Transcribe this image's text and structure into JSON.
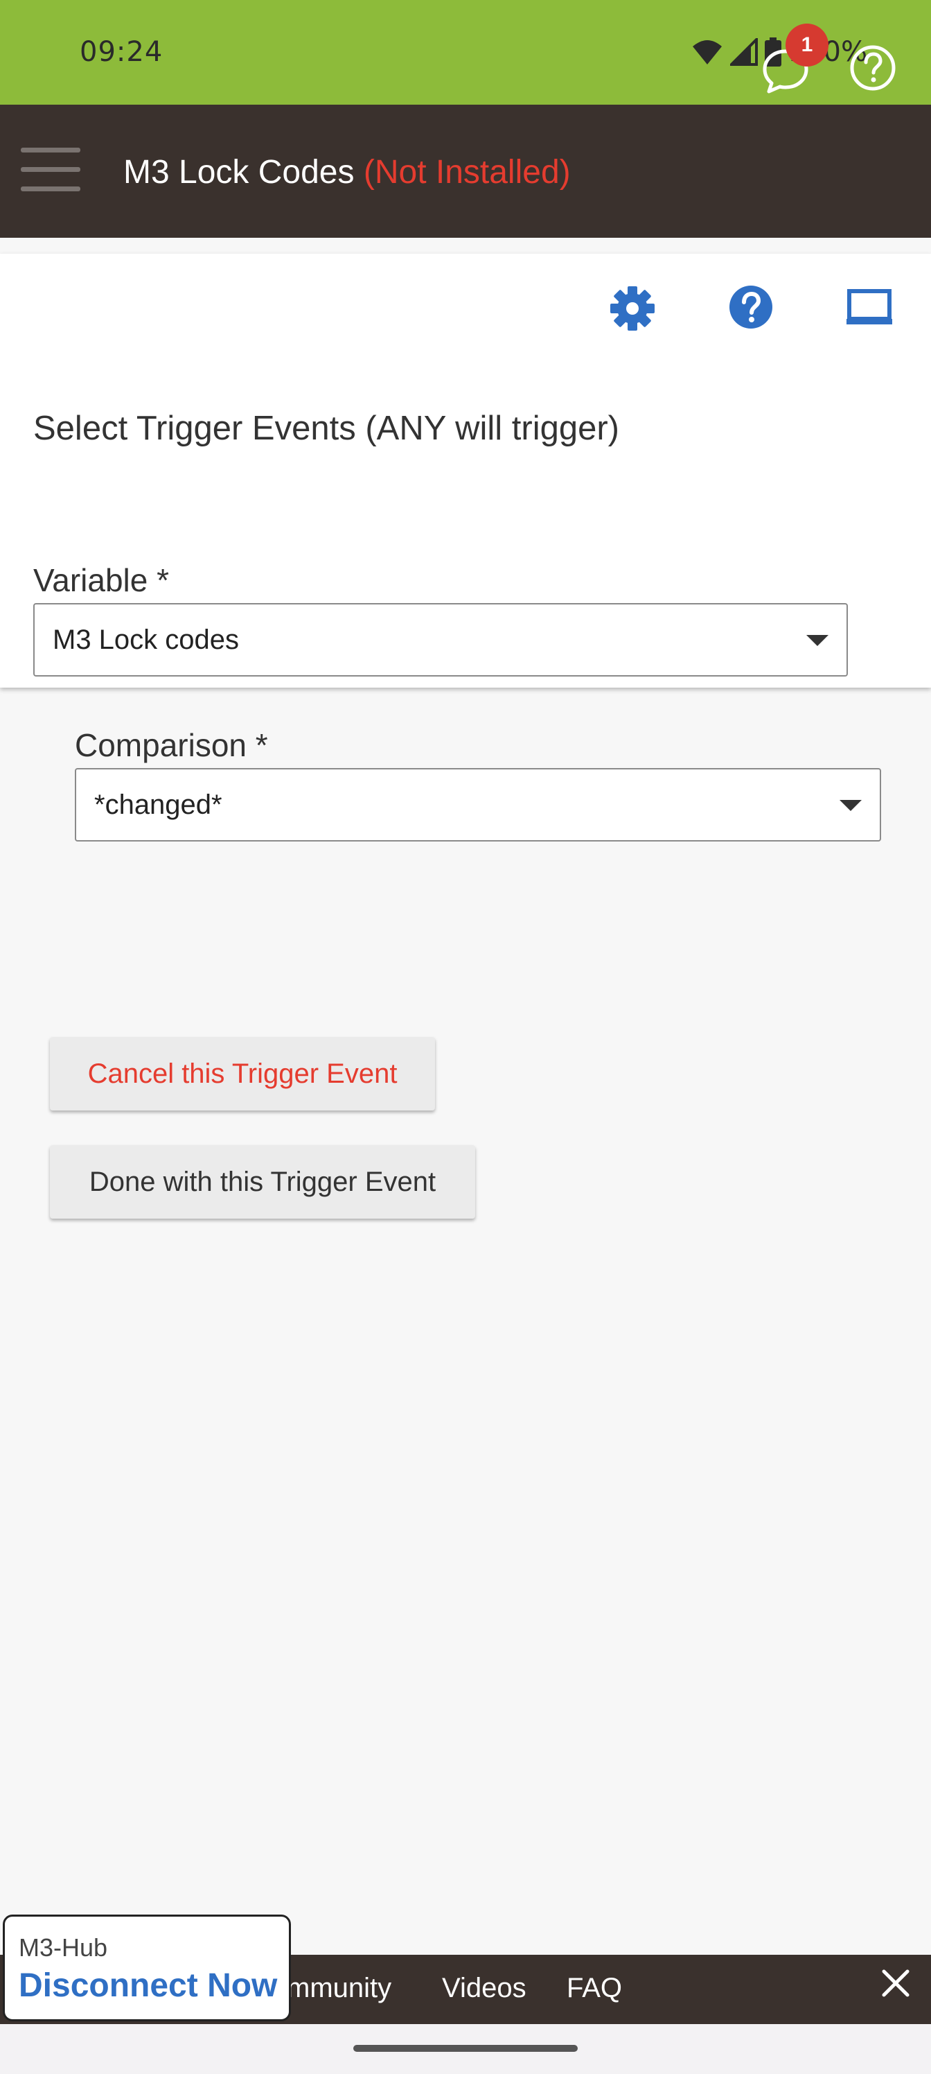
{
  "status_bar": {
    "time": "09:24",
    "battery_percent": "100%",
    "icons": [
      "wifi-icon",
      "signal-icon",
      "battery-icon"
    ]
  },
  "header": {
    "title": "M3 Lock Codes",
    "status": "(Not Installed)",
    "notification_count": "1",
    "icons": [
      "menu-icon",
      "chat-icon",
      "help-circle-icon"
    ]
  },
  "toolbar": {
    "icons": [
      "gear-icon",
      "help-icon",
      "monitor-icon"
    ]
  },
  "form": {
    "section_title": "Select Trigger Events (ANY will trigger)",
    "variable_label": "Variable *",
    "variable_value": "M3 Lock codes",
    "comparison_label": "Comparison *",
    "comparison_value": "*changed*"
  },
  "buttons": {
    "cancel_label": "Cancel this Trigger Event",
    "done_label": "Done with this Trigger Event"
  },
  "bottom_nav": {
    "links": [
      "mmunity",
      "Videos",
      "FAQ"
    ],
    "close_icon": "close-icon"
  },
  "hub_popup": {
    "hub_name": "M3-Hub",
    "action_label": "Disconnect Now"
  },
  "colors": {
    "status_bar": "#8dbb3a",
    "app_bar": "#3a312d",
    "accent_red": "#e53c2f",
    "icon_blue": "#2f6fc4"
  }
}
